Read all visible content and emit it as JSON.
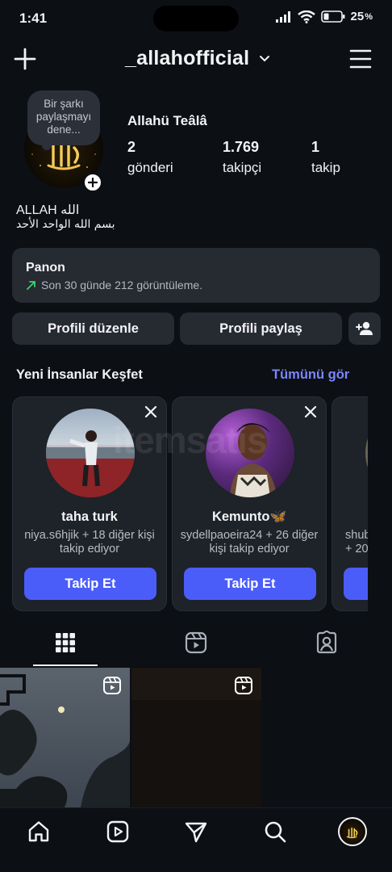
{
  "status_bar": {
    "time": "1:41",
    "battery": "25"
  },
  "header": {
    "username": "_allahofficial"
  },
  "profile": {
    "note": "Bir şarkı paylaşmayı dene...",
    "avatar_text": "الله",
    "display_name": "Allahü Teâlâ",
    "stats": [
      {
        "num": "2",
        "label": "gönderi"
      },
      {
        "num": "1.769",
        "label": "takipçi"
      },
      {
        "num": "1",
        "label": "takip"
      }
    ],
    "bio_name": "ALLAH الله",
    "bio_line": "بسم الله الواحد الأحد"
  },
  "dashboard": {
    "title": "Panon",
    "subtitle": "Son 30 günde 212 görüntüleme."
  },
  "buttons": {
    "edit_profile": "Profili düzenle",
    "share_profile": "Profili paylaş"
  },
  "discover": {
    "title": "Yeni İnsanlar Keşfet",
    "see_all": "Tümünü gör",
    "cards": [
      {
        "name": "taha turk",
        "sub": "niya.s6hjik + 18 diğer kişi takip ediyor",
        "follow": "Takip Et"
      },
      {
        "name": "Kemunto🦋",
        "sub": "sydellpaoeira24 + 26 diğer kişi takip ediyor",
        "follow": "Takip Et"
      },
      {
        "name": "",
        "sub": "shub + 20",
        "follow": ""
      }
    ]
  },
  "watermark": "itemsatis",
  "colors": {
    "accent": "#4a5df9",
    "link": "#7a87ff",
    "background": "#0c0f14",
    "card": "#1e2229",
    "growth": "#3ecf6e"
  }
}
